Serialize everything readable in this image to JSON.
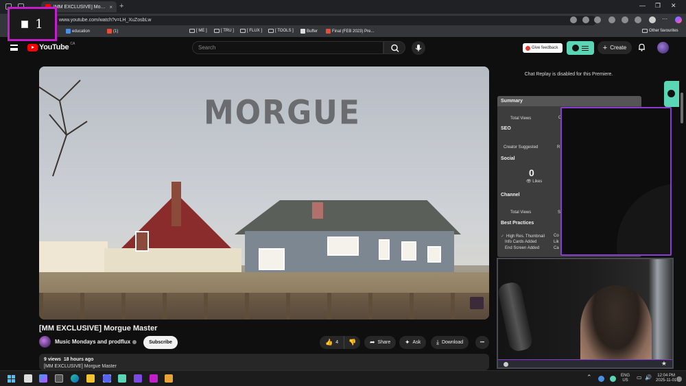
{
  "browser": {
    "tab_title": "[MM EXCLUSIVE] Morgue Master",
    "new_tab": "+",
    "url": "www.youtube.com/watch?v=LH_XuZosbLw",
    "bookmarks": [
      "education",
      "(1)",
      "[ ME ]",
      "[ TRU ]",
      "[ FLUX ]",
      "[ TOOLS ]",
      "Buffer",
      "Final (FEB 2023) Pre...",
      "Other favourites"
    ]
  },
  "recording_badge": {
    "number": "1"
  },
  "youtube": {
    "logo_text": "YouTube",
    "region": "CA",
    "search_placeholder": "Search",
    "feedback_label": "Give feedback",
    "create_label": "Create"
  },
  "player": {
    "art_title": "MORGUE"
  },
  "video": {
    "title": "[MM EXCLUSIVE] Morgue Master",
    "channel": "Music Mondays and prodflux",
    "subscribe_label": "Subscribe",
    "likes": "4",
    "share_label": "Share",
    "ask_label": "Ask",
    "download_label": "Download",
    "more_label": "•••",
    "views": "9 views",
    "age": "18 hours ago",
    "desc_line": "[MM EXCLUSIVE] Morgue Master"
  },
  "sidebar": {
    "chat_replay": "Chat Replay is disabled for this Premiere.",
    "summary": "Summary",
    "total_views": "Total Views",
    "seo": "SEO",
    "creator_suggested": "Creator Suggested",
    "social": "Social",
    "likes_count": "0",
    "likes_label": "Likes",
    "channel": "Channel",
    "channel_total_views": "Total Views",
    "best_practices": "Best Practices",
    "bp_items": [
      "High Res. Thumbnail",
      "Info Cards Added",
      "End Screen Added"
    ],
    "cut_letters": [
      "C",
      "R",
      "S",
      "Co",
      "Lik",
      "Ca"
    ]
  },
  "webcam": {
    "star": "★"
  },
  "taskbar": {
    "lang_top": "ENG",
    "lang_bottom": "US",
    "time": "12:04 PM",
    "date": "2025-11-01"
  }
}
